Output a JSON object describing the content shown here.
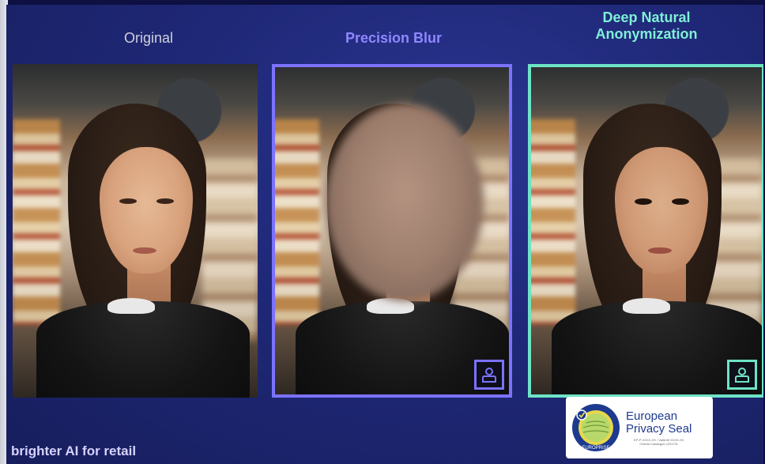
{
  "headings": {
    "original": "Original",
    "precision_blur": "Precision Blur",
    "deep_natural": "Deep Natural\nAnonymization"
  },
  "footer": {
    "tagline": "brighter AI for retail"
  },
  "seal": {
    "name_line1": "European",
    "name_line2": "Privacy Seal",
    "ring_text": "EUROPRISE",
    "fine_print": "EP-P-XXXX-XX / Valid till XXXX-XX\nCriteria Catalogue v201701"
  },
  "colors": {
    "blur_accent": "#7b72ff",
    "anonymization_accent": "#6ee3c6",
    "background": "#1f2877"
  },
  "icons": {
    "badge": "id-card-person-icon"
  }
}
